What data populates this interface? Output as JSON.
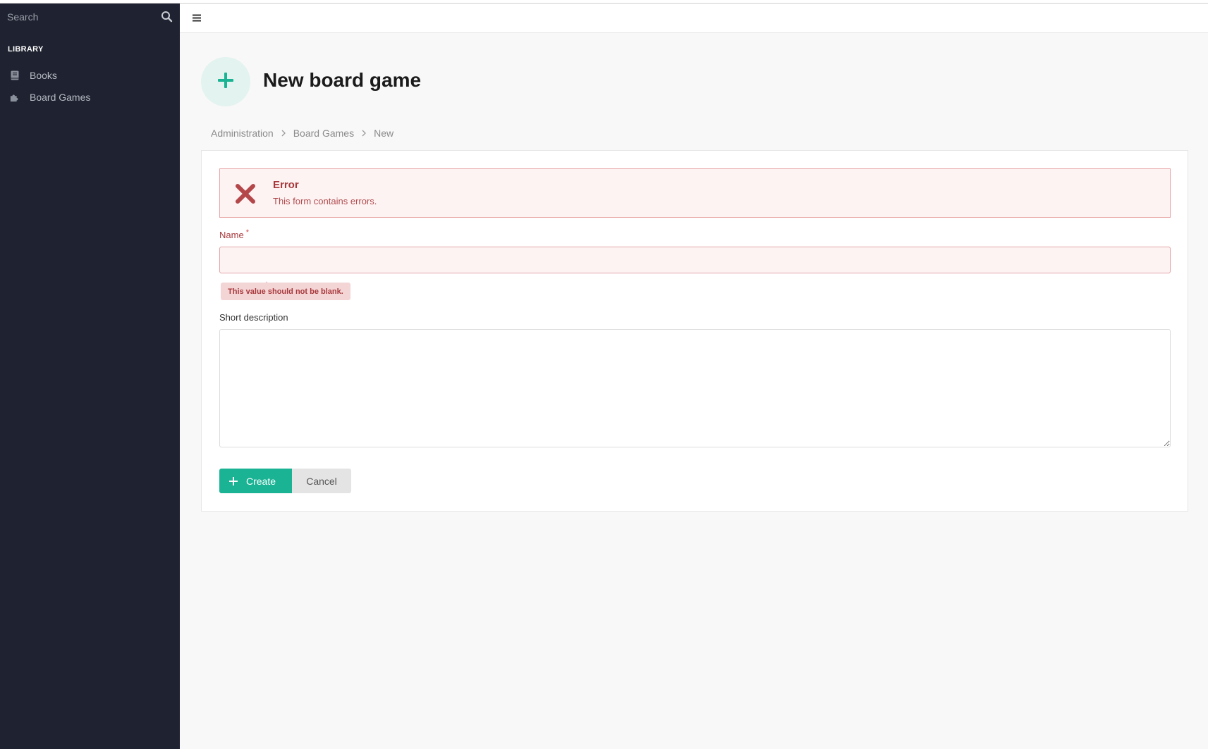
{
  "sidebar": {
    "search": {
      "placeholder": "Search",
      "icon": "search-icon"
    },
    "heading": "LIBRARY",
    "items": [
      {
        "label": "Books",
        "icon": "book-icon"
      },
      {
        "label": "Board Games",
        "icon": "puzzle-icon"
      }
    ]
  },
  "topbar": {
    "menu_icon": "hamburger-icon"
  },
  "page": {
    "title": "New board game",
    "header_icon": "plus-icon",
    "breadcrumb": [
      "Administration",
      "Board Games",
      "New"
    ]
  },
  "form": {
    "alert": {
      "title": "Error",
      "message": "This form contains errors.",
      "icon": "close-icon"
    },
    "name": {
      "label": "Name",
      "required_mark": "*",
      "value": "",
      "error": "This value should not be blank."
    },
    "description": {
      "label": "Short description",
      "value": ""
    },
    "actions": {
      "create_label": "Create",
      "cancel_label": "Cancel"
    }
  },
  "colors": {
    "sidebar_bg": "#1f2230",
    "accent": "#1ab394",
    "error": "#a8383b",
    "error_bg": "#fdf3f3"
  }
}
